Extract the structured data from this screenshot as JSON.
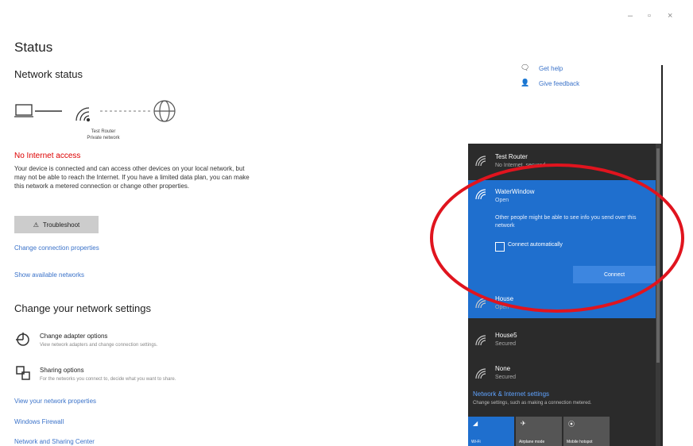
{
  "window": {
    "minimize": "–",
    "maximize": "▫",
    "close": "×"
  },
  "header": {
    "title": "Status",
    "subtitle": "Network status"
  },
  "diagram": {
    "router_name": "Test Router",
    "router_type": "Private network"
  },
  "status": {
    "alert": "No Internet access",
    "description": "Your device is connected and can access other devices on your local network, but may not be able to reach the Internet. If you have a limited data plan, you can make this network a metered connection or change other properties.",
    "troubleshoot_label": "Troubleshoot",
    "change_connection_link": "Change connection properties",
    "show_networks_link": "Show available networks"
  },
  "settings_section": {
    "title": "Change your network settings",
    "options": [
      {
        "title": "Change adapter options",
        "subtitle": "View network adapters and change connection settings."
      },
      {
        "title": "Sharing options",
        "subtitle": "For the networks you connect to, decide what you want to share."
      }
    ],
    "links": [
      "View your network properties",
      "Windows Firewall",
      "Network and Sharing Center"
    ]
  },
  "help": {
    "get_help": "Get help",
    "give_feedback": "Give feedback"
  },
  "flyout": {
    "networks": [
      {
        "name": "Test Router",
        "status": "No Internet, secured"
      },
      {
        "name": "WaterWindow",
        "status": "Open",
        "warning": "Other people might be able to see info you send over this network",
        "auto_connect_label": "Connect automatically",
        "connect_label": "Connect"
      },
      {
        "name": "House",
        "status": "Open"
      },
      {
        "name": "House5",
        "status": "Secured"
      },
      {
        "name": "None",
        "status": "Secured"
      }
    ],
    "settings_title": "Network & Internet settings",
    "settings_sub": "Change settings, such as making a connection metered.",
    "tiles": [
      {
        "label": "Wi-Fi",
        "active": true
      },
      {
        "label": "Airplane mode",
        "active": false
      },
      {
        "label": "Mobile hotspot",
        "active": false
      }
    ]
  },
  "colors": {
    "accent": "#1f6fce",
    "alert": "#dd0000",
    "link": "#3a72c9",
    "annotation": "#e0141e"
  }
}
